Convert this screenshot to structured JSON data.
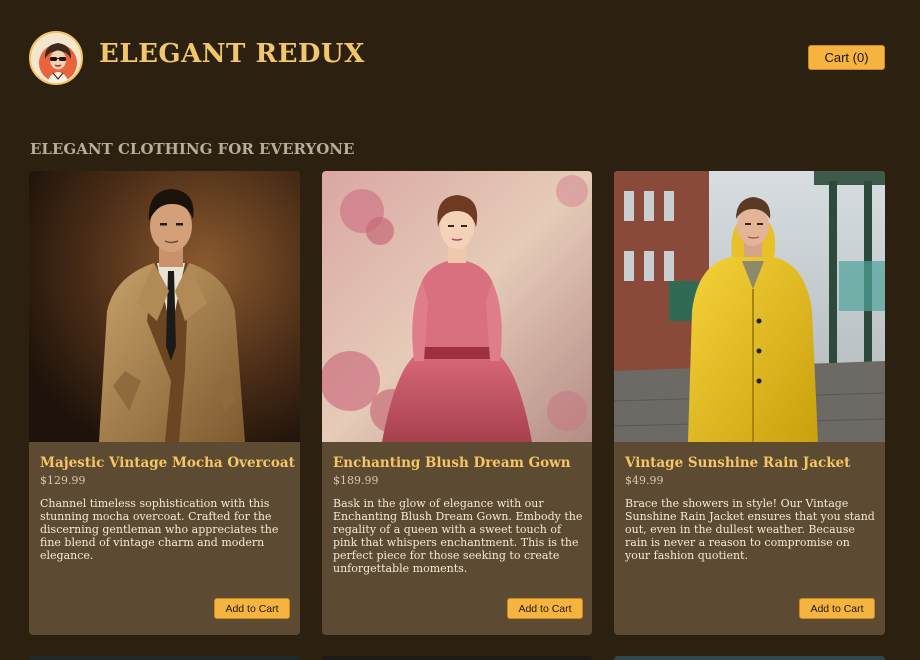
{
  "header": {
    "brand": "ELEGANT REDUX",
    "cart_label": "Cart (0)"
  },
  "main": {
    "section_title": "ELEGANT CLOTHING FOR EVERYONE",
    "products": [
      {
        "name": "Majestic Vintage Mocha Overcoat",
        "price": "$129.99",
        "description": "Channel timeless sophistication with this stunning mocha overcoat. Crafted for the discerning gentleman who appreciates the fine blend of vintage charm and modern elegance.",
        "button": "Add to Cart"
      },
      {
        "name": "Enchanting Blush Dream Gown",
        "price": "$189.99",
        "description": "Bask in the glow of elegance with our Enchanting Blush Dream Gown. Embody the regality of a queen with a sweet touch of pink that whispers enchantment. This is the perfect piece for those seeking to create unforgettable moments.",
        "button": "Add to Cart"
      },
      {
        "name": "Vintage Sunshine Rain Jacket",
        "price": "$49.99",
        "description": "Brace the showers in style! Our Vintage Sunshine Rain Jacket ensures that you stand out, even in the dullest weather. Because rain is never a reason to compromise on your fashion quotient.",
        "button": "Add to Cart"
      }
    ]
  },
  "theme": {
    "background": "#2c2111",
    "card": "#5c4b32",
    "accent": "#f5b43f",
    "title_gold": "#f2c66d"
  }
}
